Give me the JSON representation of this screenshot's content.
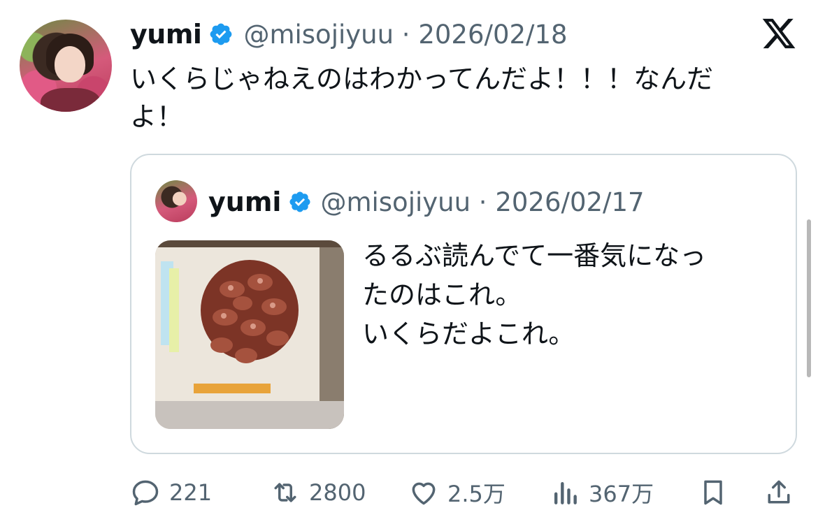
{
  "tweet": {
    "author_name": "yumi",
    "handle_date": "@misojiyuu · 2026/02/18",
    "text": "いくらじゃねえのはわかってんだよ！！！なんだ\nよ！"
  },
  "quoted": {
    "author_name": "yumi",
    "handle_date": "@misojiyuu · 2026/02/17",
    "text": "るるぶ読んでて一番気になっ\nたのはこれ。\nいくらだよこれ。",
    "image_icon": "magazine-photo"
  },
  "actions": {
    "replies": "221",
    "retweets": "2800",
    "likes": "2.5万",
    "views": "367万"
  },
  "icons": {
    "verified": "verified-badge-icon",
    "logo": "x-logo-icon",
    "reply": "reply-icon",
    "retweet": "retweet-icon",
    "like": "heart-icon",
    "views": "views-icon",
    "bookmark": "bookmark-icon",
    "share": "share-icon"
  },
  "colors": {
    "verified": "#1d9bf0",
    "muted": "#536471",
    "text": "#0f1419",
    "border": "#cfd9de"
  }
}
